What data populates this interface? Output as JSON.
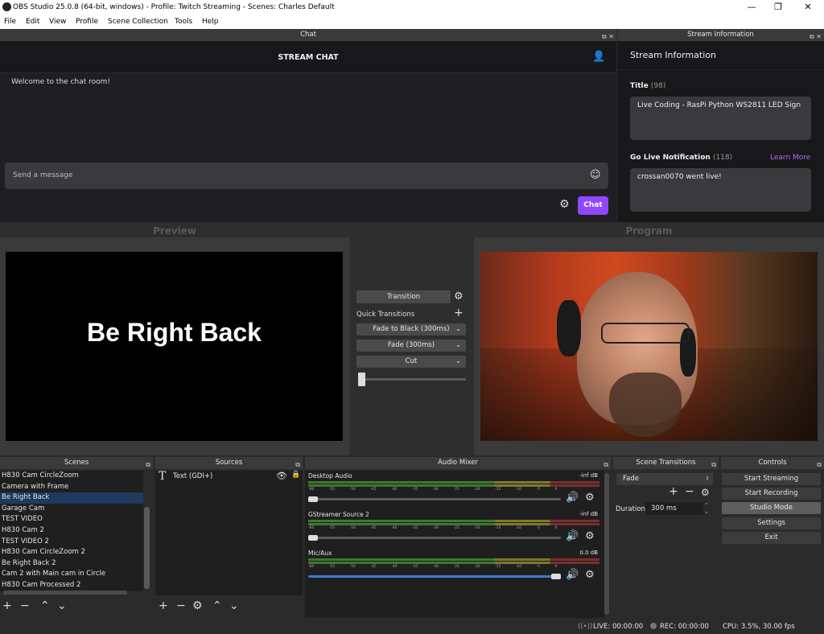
{
  "window": {
    "title": "OBS Studio 25.0.8 (64-bit, windows) - Profile: Twitch Streaming - Scenes: Charles Default"
  },
  "menu": [
    "File",
    "Edit",
    "View",
    "Profile",
    "Scene Collection",
    "Tools",
    "Help"
  ],
  "chat": {
    "dock_title": "Chat",
    "header": "STREAM CHAT",
    "welcome": "Welcome to the chat room!",
    "input_placeholder": "Send a message",
    "chat_button": "Chat"
  },
  "stream_info": {
    "dock_title": "Stream Information",
    "heading": "Stream Information",
    "title_label": "Title",
    "title_count": "(98)",
    "title_value": "Live Coding - RasPi Python WS2811 LED Sign",
    "golive_label": "Go Live Notification",
    "golive_count": "(118)",
    "learn_more": "Learn More",
    "golive_value": "crossan0070 went live!"
  },
  "preview": {
    "label": "Preview",
    "scene_text": "Be Right Back"
  },
  "program": {
    "label": "Program"
  },
  "transitions_mid": {
    "transition_button": "Transition",
    "quick_label": "Quick Transitions",
    "items": [
      "Fade to Black (300ms)",
      "Fade (300ms)",
      "Cut"
    ]
  },
  "scenes": {
    "title": "Scenes",
    "items": [
      "H830 Cam CircleZoom",
      "Camera with Frame",
      "Be Right Back",
      "Garage Cam",
      "TEST VIDEO",
      "H830 Cam 2",
      "TEST VIDEO 2",
      "H830 Cam CircleZoom 2",
      "Be Right Back 2",
      "Cam 2 with Main cam in Circle",
      "H830 Cam Processed 2"
    ],
    "selected_index": 2
  },
  "sources": {
    "title": "Sources",
    "items": [
      "Text (GDI+)"
    ]
  },
  "mixer": {
    "title": "Audio Mixer",
    "tick_labels": "-60 -55 -50 -45 -40 -35 -30 -25 -20 -15 -10 -5 0",
    "channels": [
      {
        "name": "Desktop Audio",
        "level": "-inf dB",
        "volume": 0.0
      },
      {
        "name": "GStreamer Source 2",
        "level": "-inf dB",
        "volume": 0.0
      },
      {
        "name": "Mic/Aux",
        "level": "0.0 dB",
        "volume": 1.0
      }
    ]
  },
  "scene_transitions": {
    "title": "Scene Transitions",
    "selected": "Fade",
    "duration_label": "Duration",
    "duration_value": "300 ms"
  },
  "controls": {
    "title": "Controls",
    "buttons": [
      "Start Streaming",
      "Start Recording",
      "Studio Mode",
      "Settings",
      "Exit"
    ]
  },
  "status": {
    "live": "LIVE: 00:00:00",
    "rec": "REC: 00:00:00",
    "cpu": "CPU: 3.5%, 30.00 fps"
  },
  "colors": {
    "accent": "#9147ff",
    "selected": "#1e3a5f",
    "meter_green": "#3b7a2e"
  }
}
